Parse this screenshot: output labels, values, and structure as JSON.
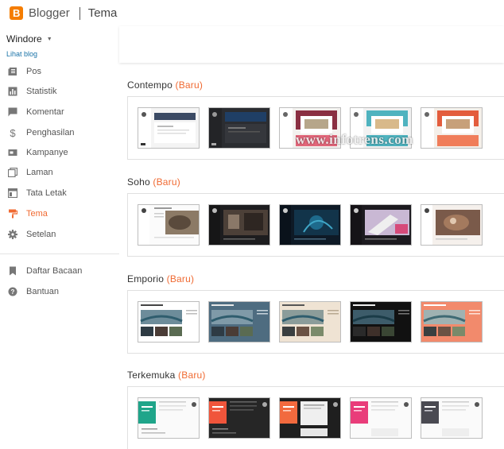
{
  "header": {
    "brand": "Blogger",
    "page": "Tema",
    "logo_letter": "B",
    "accent": "#f57d00"
  },
  "sidebar": {
    "blog_name": "Windore",
    "view_blog": "Lihat blog",
    "active_color": "#f06a32",
    "items": [
      {
        "label": "Pos",
        "icon": "posts-icon"
      },
      {
        "label": "Statistik",
        "icon": "stats-icon"
      },
      {
        "label": "Komentar",
        "icon": "comment-icon"
      },
      {
        "label": "Penghasilan",
        "icon": "dollar-icon"
      },
      {
        "label": "Kampanye",
        "icon": "campaign-icon"
      },
      {
        "label": "Laman",
        "icon": "pages-icon"
      },
      {
        "label": "Tata Letak",
        "icon": "layout-icon"
      },
      {
        "label": "Tema",
        "icon": "paint-roller-icon",
        "active": true
      },
      {
        "label": "Setelan",
        "icon": "gear-icon"
      },
      {
        "label": "Daftar Bacaan",
        "icon": "bookmark-icon"
      },
      {
        "label": "Bantuan",
        "icon": "help-icon"
      }
    ]
  },
  "sections": [
    {
      "name": "Contempo",
      "badge": "(Baru)",
      "themes": [
        "Contempo 1",
        "Contempo 2",
        "Contempo 3",
        "Contempo 4",
        "Contempo 5"
      ]
    },
    {
      "name": "Soho",
      "badge": "(Baru)",
      "themes": [
        "Soho 1",
        "Soho 2",
        "Soho 3",
        "Soho 4",
        "Soho 5"
      ]
    },
    {
      "name": "Emporio",
      "badge": "(Baru)",
      "themes": [
        "Emporio 1",
        "Emporio 2",
        "Emporio 3",
        "Emporio 4",
        "Emporio 5"
      ]
    },
    {
      "name": "Terkemuka",
      "badge": "(Baru)",
      "themes": [
        "Terkemuka 1",
        "Terkemuka 2",
        "Terkemuka 3",
        "Terkemuka 4",
        "Terkemuka 5"
      ]
    }
  ],
  "watermark": "www.infotrens.com"
}
